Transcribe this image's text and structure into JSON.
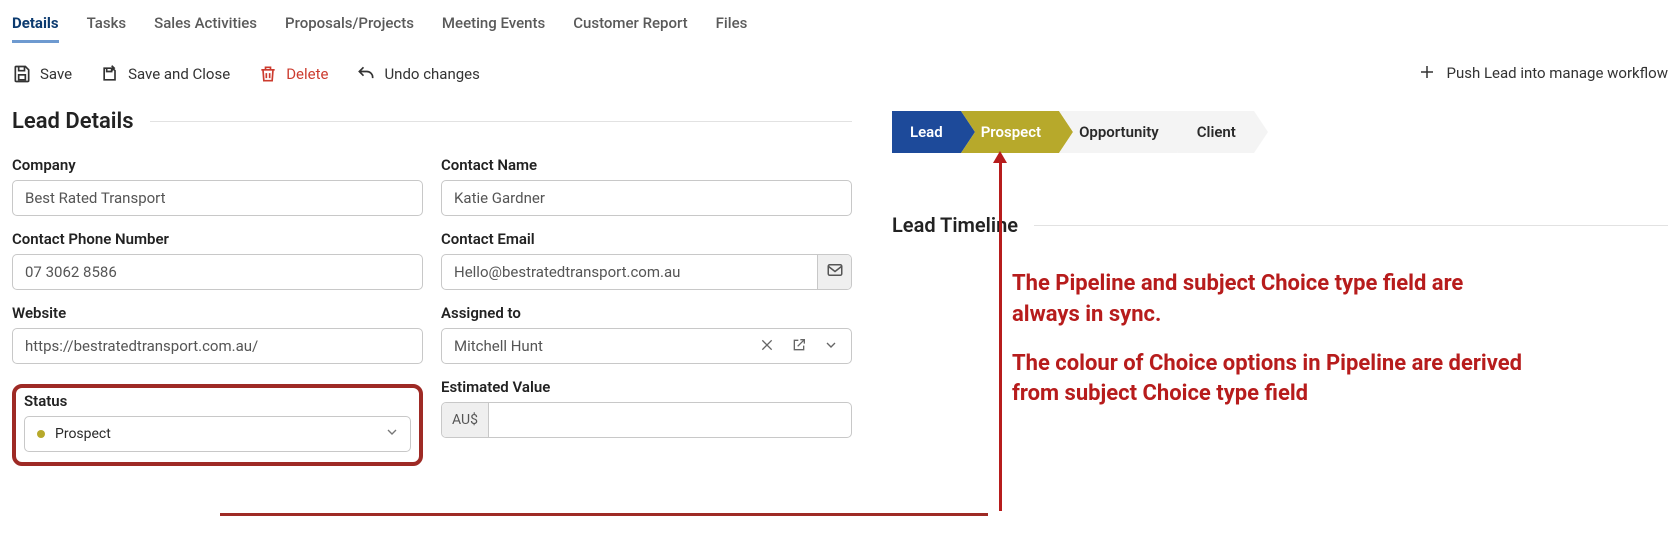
{
  "tabs": {
    "details": "Details",
    "tasks": "Tasks",
    "sales_activities": "Sales Activities",
    "proposals": "Proposals/Projects",
    "meeting_events": "Meeting Events",
    "customer_report": "Customer Report",
    "files": "Files"
  },
  "toolbar": {
    "save": "Save",
    "save_close": "Save and Close",
    "delete": "Delete",
    "undo": "Undo changes",
    "push_workflow": "Push Lead into manage workflow"
  },
  "section": {
    "lead_details": "Lead Details"
  },
  "form": {
    "company": {
      "label": "Company",
      "value": "Best Rated Transport"
    },
    "contact_name": {
      "label": "Contact Name",
      "value": "Katie Gardner"
    },
    "contact_phone": {
      "label": "Contact Phone Number",
      "value": "07 3062 8586"
    },
    "contact_email": {
      "label": "Contact Email",
      "value": "Hello@bestratedtransport.com.au"
    },
    "website": {
      "label": "Website",
      "value": "https://bestratedtransport.com.au/"
    },
    "assigned_to": {
      "label": "Assigned to",
      "value": "Mitchell Hunt"
    },
    "status": {
      "label": "Status",
      "value": "Prospect"
    },
    "estimated_value": {
      "label": "Estimated Value",
      "prefix": "AU$",
      "value": ""
    }
  },
  "pipeline": {
    "lead": "Lead",
    "prospect": "Prospect",
    "opportunity": "Opportunity",
    "client": "Client"
  },
  "right": {
    "lead_timeline": "Lead Timeline"
  },
  "annotations": {
    "line1": "The Pipeline and subject Choice type field are always in sync.",
    "line2": "The colour of Choice options in Pipeline are derived from subject Choice type field"
  }
}
